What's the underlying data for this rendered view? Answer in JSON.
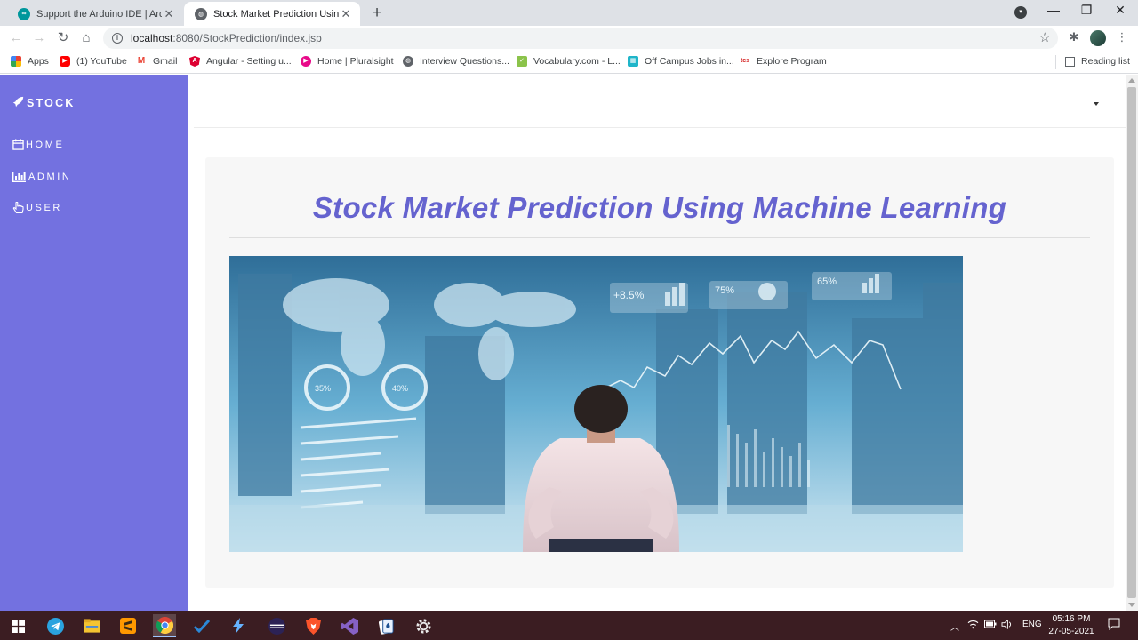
{
  "browser": {
    "tabs": [
      {
        "title": "Support the Arduino IDE | Arduino",
        "active": false
      },
      {
        "title": "Stock Market Prediction Using M",
        "active": true
      }
    ],
    "url_host": "localhost",
    "url_path": ":8080/StockPrediction/index.jsp",
    "bookmarks": [
      {
        "label": "Apps",
        "icon": "apps-grid-icon"
      },
      {
        "label": "(1) YouTube",
        "icon": "youtube-icon"
      },
      {
        "label": "Gmail",
        "icon": "gmail-icon"
      },
      {
        "label": "Angular - Setting u...",
        "icon": "angular-icon"
      },
      {
        "label": "Home | Pluralsight",
        "icon": "pluralsight-icon"
      },
      {
        "label": "Interview Questions...",
        "icon": "globe-icon"
      },
      {
        "label": "Vocabulary.com - L...",
        "icon": "vocabulary-icon"
      },
      {
        "label": "Off Campus Jobs in...",
        "icon": "jobs-icon"
      },
      {
        "label": "Explore Program",
        "icon": "tcs-icon"
      }
    ],
    "reading_list": "Reading list"
  },
  "sidebar": {
    "brand": "STOCK",
    "items": [
      {
        "label": "HOME",
        "icon": "calendar-icon"
      },
      {
        "label": "ADMIN",
        "icon": "bar-chart-icon"
      },
      {
        "label": "USER",
        "icon": "hand-pointer-icon"
      }
    ]
  },
  "main": {
    "heading": "Stock Market Prediction Using Machine Learning",
    "hero_overlay": {
      "top_labels": [
        "+8.5%",
        "75%",
        "65%"
      ],
      "rings": [
        "35%",
        "40%"
      ]
    }
  },
  "taskbar": {
    "language": "ENG",
    "time": "05:16 PM",
    "date": "27-05-2021"
  },
  "colors": {
    "sidebar": "#7371e0",
    "heading": "#6563cf",
    "taskbar": "#3b1d22"
  }
}
